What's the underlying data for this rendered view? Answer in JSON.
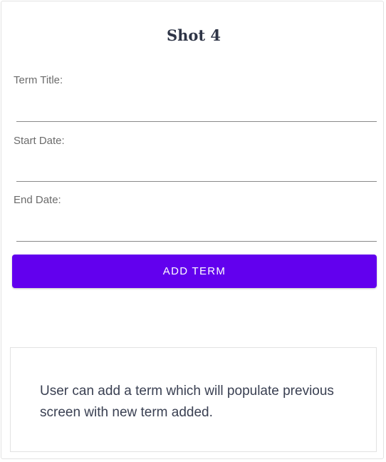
{
  "header": {
    "title": "Shot 4"
  },
  "form": {
    "fields": [
      {
        "label": "Term Title:",
        "value": ""
      },
      {
        "label": "Start Date:",
        "value": ""
      },
      {
        "label": "End Date:",
        "value": ""
      }
    ],
    "submit_label": "ADD TERM"
  },
  "caption": {
    "text": "User can add a term which will populate previous screen with new term added."
  },
  "colors": {
    "accent": "#6200ee",
    "title": "#2e3446",
    "label": "#6b6b6b"
  }
}
